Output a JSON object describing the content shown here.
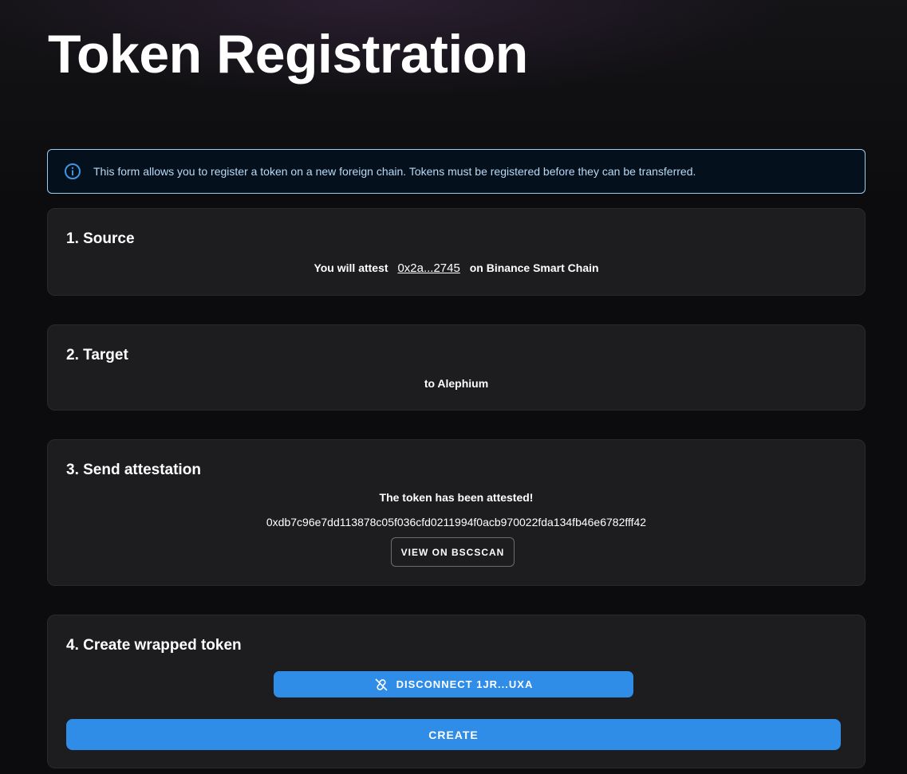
{
  "page": {
    "title": "Token Registration"
  },
  "info": {
    "icon": "info-icon",
    "text": "This form allows you to register a token on a new foreign chain. Tokens must be registered before they can be transferred."
  },
  "source": {
    "title": "1. Source",
    "prefix": "You will attest",
    "address": "0x2a...2745",
    "suffix": "on Binance Smart Chain"
  },
  "target": {
    "title": "2. Target",
    "text": "to Alephium"
  },
  "attestation": {
    "title": "3. Send attestation",
    "status": "The token has been attested!",
    "tx_hash": "0xdb7c96e7dd113878c05f036cfd0211994f0acb970022fda134fb46e6782fff42",
    "view_button": "VIEW ON BSCSCAN"
  },
  "create": {
    "title": "4. Create wrapped token",
    "disconnect_button": "DISCONNECT 1JR...UXA",
    "disconnect_icon": "link-off-icon",
    "create_button": "CREATE"
  },
  "colors": {
    "accent": "#2f8de8",
    "card_bg": "#1d1d20",
    "info_border": "#9ecbf0"
  }
}
